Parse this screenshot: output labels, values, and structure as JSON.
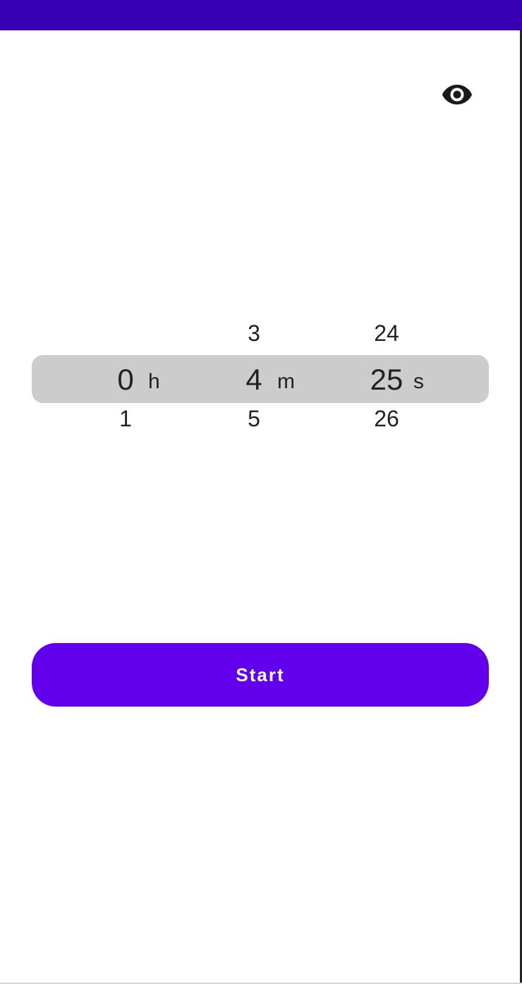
{
  "colors": {
    "status_bar": "#3700b3",
    "primary": "#6200ee",
    "picker_band": "#cccccc",
    "text": "#222222"
  },
  "toolbar": {
    "visibility_icon": "eye-icon"
  },
  "picker": {
    "hours": {
      "above": "",
      "selected": "0",
      "below": "1",
      "unit": "h"
    },
    "minutes": {
      "above": "3",
      "selected": "4",
      "below": "5",
      "unit": "m"
    },
    "seconds": {
      "above": "24",
      "selected": "25",
      "below": "26",
      "unit": "s"
    }
  },
  "start_button": {
    "label": "Start"
  }
}
